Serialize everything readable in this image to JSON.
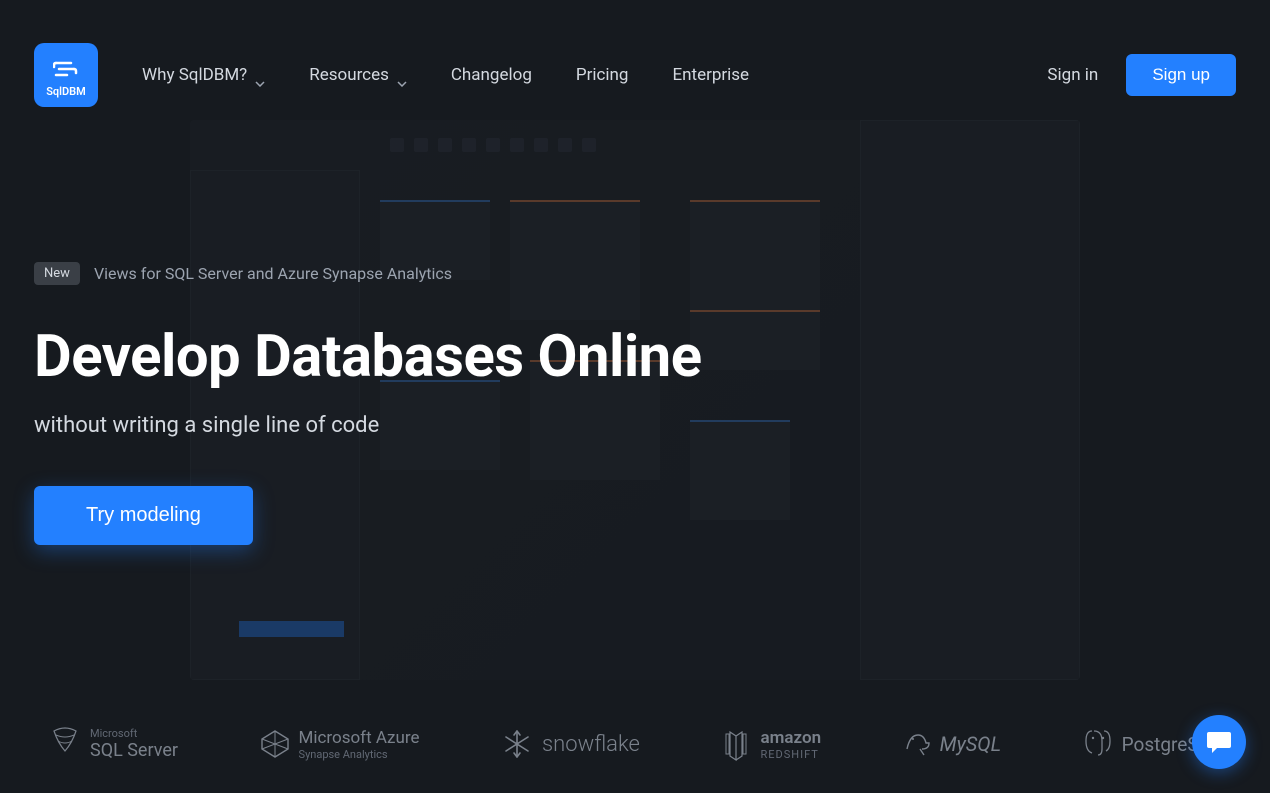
{
  "logo": {
    "text": "SqlDBM"
  },
  "nav": {
    "items": [
      {
        "label": "Why SqlDBM?",
        "dropdown": true
      },
      {
        "label": "Resources",
        "dropdown": true
      },
      {
        "label": "Changelog",
        "dropdown": false
      },
      {
        "label": "Pricing",
        "dropdown": false
      },
      {
        "label": "Enterprise",
        "dropdown": false
      }
    ]
  },
  "auth": {
    "signin": "Sign in",
    "signup": "Sign up"
  },
  "hero": {
    "badge": "New",
    "badge_text": "Views for SQL Server and Azure Synapse Analytics",
    "title": "Develop Databases Online",
    "subtitle": "without writing a single line of code",
    "cta": "Try modeling"
  },
  "partners": [
    {
      "primary": "SQL Server",
      "prefix": "Microsoft"
    },
    {
      "primary": "Microsoft Azure",
      "sub": "Synapse Analytics"
    },
    {
      "primary": "snowflake"
    },
    {
      "primary": "amazon",
      "sub": "REDSHIFT"
    },
    {
      "primary": "MySQL"
    },
    {
      "primary": "PostgreSQL"
    }
  ]
}
